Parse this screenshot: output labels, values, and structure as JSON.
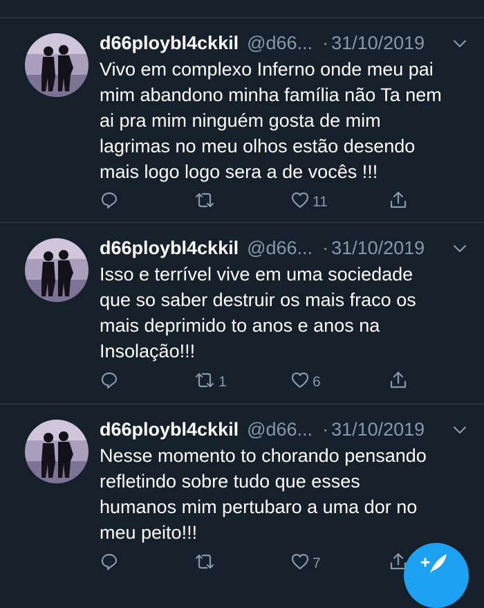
{
  "colors": {
    "background": "#15202b",
    "divider": "#38444d",
    "secondary_text": "#8899a6",
    "accent": "#1da1f2"
  },
  "tweets": [
    {
      "name": "d66ploybl4ckkil",
      "handle": "@d66...",
      "separator": "·",
      "date": "31/10/2019",
      "lines": [
        "Vivo em complexo Inferno onde meu pai",
        "mim abandono minha família não Ta nem",
        "ai pra mim ninguém gosta de mim",
        "lagrimas no meu olhos estão desendo",
        "mais logo logo sera a de vocês !!!"
      ],
      "reply_count": "",
      "retweet_count": "",
      "like_count": "11"
    },
    {
      "name": "d66ploybl4ckkil",
      "handle": "@d66...",
      "separator": "·",
      "date": "31/10/2019",
      "lines": [
        "Isso e terrível vive em uma sociedade",
        "que so saber destruir os mais fraco os",
        "mais deprimido to anos e anos na",
        "Insolação!!!"
      ],
      "reply_count": "",
      "retweet_count": "1",
      "like_count": "6"
    },
    {
      "name": "d66ploybl4ckkil",
      "handle": "@d66...",
      "separator": "·",
      "date": "31/10/2019",
      "lines": [
        "Nesse momento to chorando pensando",
        "refletindo sobre tudo que esses",
        "humanos mim pertubaro a uma dor no",
        "meu peito!!!"
      ],
      "reply_count": "",
      "retweet_count": "",
      "like_count": "7"
    }
  ],
  "icons": {
    "reply": "reply-icon",
    "retweet": "retweet-icon",
    "like": "heart-icon",
    "share": "share-icon",
    "menu": "chevron-down-icon",
    "compose": "compose-tweet-icon"
  }
}
